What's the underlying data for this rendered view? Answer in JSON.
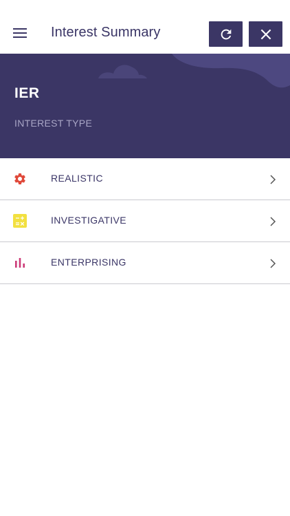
{
  "header": {
    "title": "Interest Summary",
    "menu_icon": "hamburger-menu-icon",
    "refresh_icon": "refresh-icon",
    "close_icon": "close-icon"
  },
  "banner": {
    "code": "IER",
    "subtitle": "INTEREST TYPE"
  },
  "items": [
    {
      "label": "REALISTIC",
      "icon": "gear-icon",
      "icon_color": "#e0493a"
    },
    {
      "label": "INVESTIGATIVE",
      "icon": "calculator-icon",
      "icon_color": "#f2e040"
    },
    {
      "label": "ENTERPRISING",
      "icon": "bar-chart-icon",
      "icon_color": "#cc3a77"
    }
  ],
  "colors": {
    "primary": "#3b3665",
    "text": "#3a3566",
    "divider": "#c9c9cf",
    "banner_sub": "#a9a6c6"
  }
}
